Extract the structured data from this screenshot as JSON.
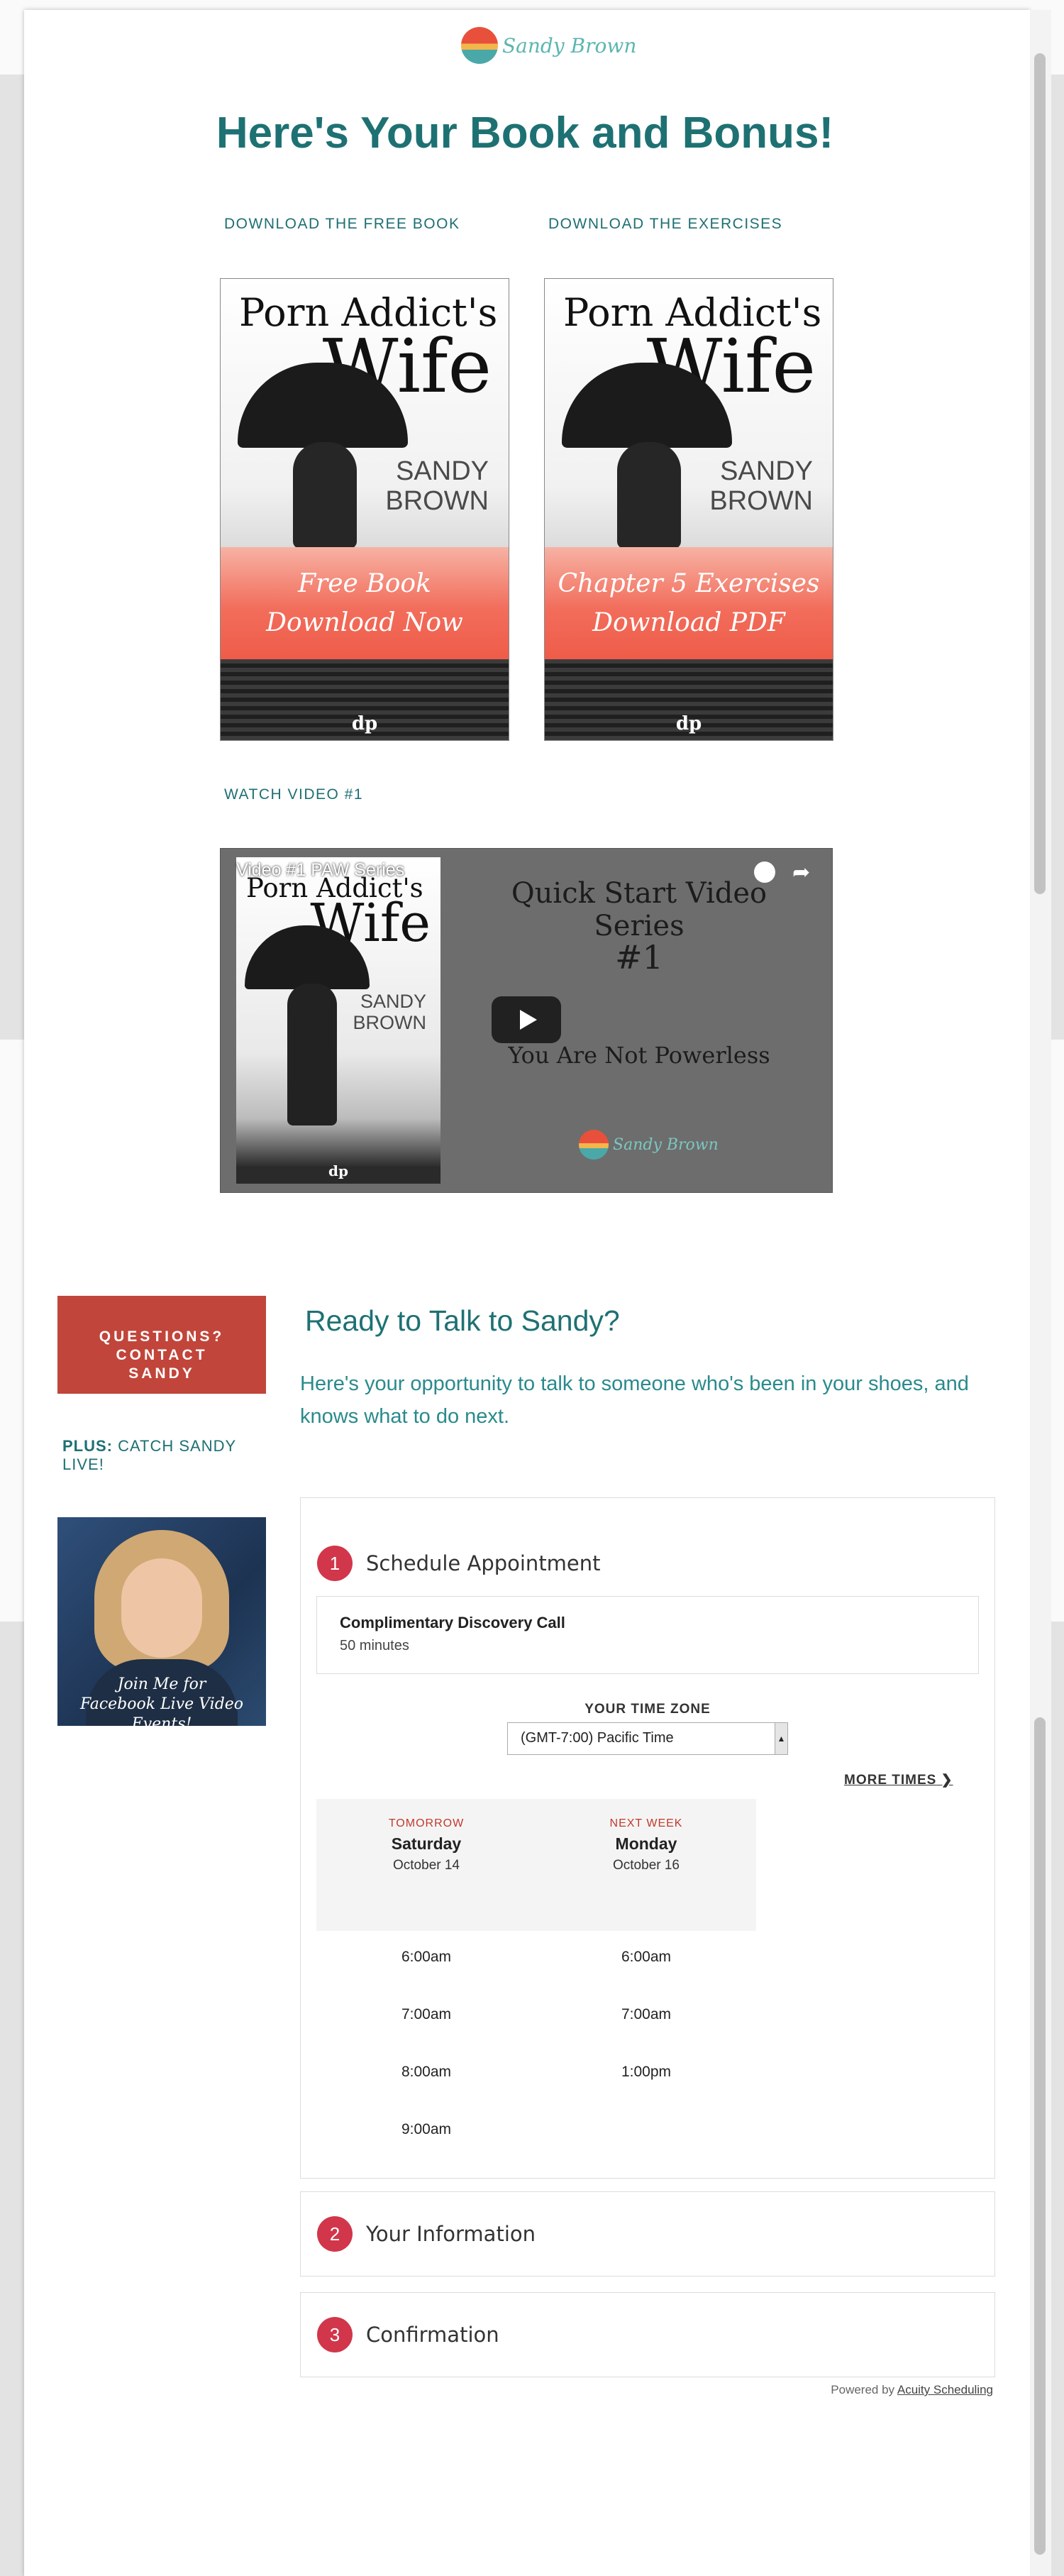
{
  "header": {
    "logo_text": "Sandy Brown",
    "headline": "Here's Your Book and Bonus!"
  },
  "downloads": {
    "book_label": "DOWNLOAD THE FREE BOOK",
    "exercises_label": "DOWNLOAD THE EXERCISES",
    "cover": {
      "title_line1": "Porn Addict's",
      "title_line2": "Wife",
      "author_line1": "SANDY",
      "author_line2": "BROWN",
      "publisher": "dp"
    },
    "book_banner": [
      "Free Book",
      "Download Now"
    ],
    "exercises_banner": [
      "Chapter 5 Exercises",
      "Download PDF"
    ]
  },
  "video": {
    "section_label": "WATCH VIDEO #1",
    "title": "Video #1 PAW Series",
    "line1": "Quick Start Video Series",
    "line2": "#1",
    "line3": "You Are Not Powerless",
    "logo_text": "Sandy Brown",
    "share_icon": "share-arrow-icon",
    "watch_later_icon": "clock-icon"
  },
  "sidebar": {
    "contact_button": [
      "QUESTIONS?",
      "CONTACT",
      "SANDY"
    ],
    "plus_bold": "PLUS:",
    "plus_text": "CATCH SANDY LIVE!",
    "photo_caption": [
      "Join Me for",
      "Facebook Live Video Events!"
    ]
  },
  "talk": {
    "heading": "Ready to Talk to Sandy?",
    "intro": "Here's your opportunity to talk to someone who's been in your shoes, and knows what to do next."
  },
  "scheduler": {
    "step1": {
      "num": "1",
      "title": "Schedule Appointment"
    },
    "step2": {
      "num": "2",
      "title": "Your Information"
    },
    "step3": {
      "num": "3",
      "title": "Confirmation"
    },
    "service": {
      "name": "Complimentary Discovery Call",
      "duration": "50 minutes"
    },
    "timezone_label": "YOUR TIME ZONE",
    "timezone_value": "(GMT-7:00) Pacific Time",
    "more_times": "MORE TIMES",
    "days": [
      {
        "when": "TOMORROW",
        "name": "Saturday",
        "date": "October 14",
        "slots": [
          "6:00am",
          "7:00am",
          "8:00am",
          "9:00am"
        ]
      },
      {
        "when": "NEXT WEEK",
        "name": "Monday",
        "date": "October 16",
        "slots": [
          "6:00am",
          "7:00am",
          "1:00pm"
        ]
      }
    ],
    "powered_prefix": "Powered by",
    "powered_link": "Acuity Scheduling"
  },
  "colors": {
    "teal": "#1e7173",
    "contact_red": "#c1453a",
    "step_red": "#d1364b",
    "banner_coral": "#f26d5b"
  }
}
